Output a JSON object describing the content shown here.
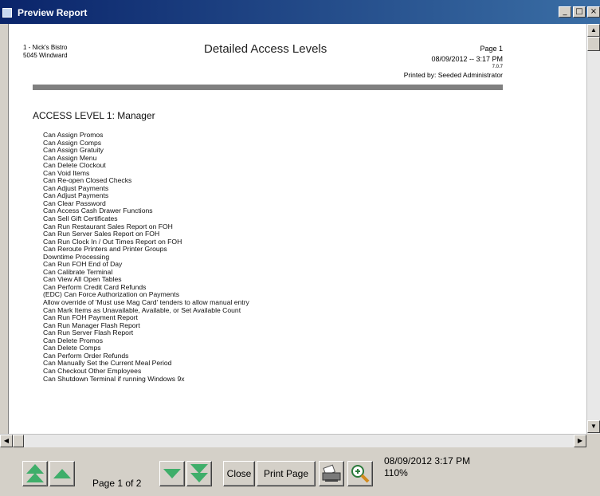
{
  "window": {
    "title": "Preview Report",
    "minimize_glyph": "_",
    "maximize_glyph": "□",
    "close_glyph": "×"
  },
  "report": {
    "restaurant_line1": "1 - Nick's Bistro",
    "restaurant_line2": "5045 Windward",
    "title": "Detailed Access Levels",
    "page": "Page 1",
    "datetime": "08/09/2012 --  3:17 PM",
    "version": "7.0.7",
    "printed_by": "Printed by: Seeded Administrator",
    "level_title": "ACCESS LEVEL 1: Manager",
    "permissions": [
      "Can Assign Promos",
      "Can Assign Comps",
      "Can Assign Gratuity",
      "Can Assign Menu",
      "Can Delete Clockout",
      "Can Void Items",
      "Can Re-open Closed Checks",
      "Can Adjust Payments",
      "Can Adjust Payments",
      "Can Clear Password",
      "Can Access Cash Drawer Functions",
      "Can Sell Gift Certificates",
      "Can Run Restaurant Sales Report on FOH",
      "Can Run Server Sales Report on FOH",
      "Can Run Clock In / Out Times Report on FOH",
      "Can Reroute Printers and Printer Groups",
      "Downtime Processing",
      "Can Run FOH End of Day",
      "Can Calibrate Terminal",
      "Can View All Open Tables",
      "Can Perform Credit Card Refunds",
      "(EDC) Can Force Authorization on Payments",
      "Allow override of 'Must use Mag Card' tenders to allow manual entry",
      "Can Mark Items as Unavailable, Available, or Set Available Count",
      "Can Run FOH Payment Report",
      "Can Run Manager Flash Report",
      "Can Run Server Flash Report",
      "Can Delete Promos",
      "Can Delete Comps",
      "Can Perform Order Refunds",
      "Can Manually Set the Current Meal Period",
      "Can Checkout Other Employees",
      "Can Shutdown Terminal if running Windows 9x"
    ]
  },
  "toolbar": {
    "first_page_icon": "double-up-arrow-icon",
    "prev_page_icon": "up-arrow-icon",
    "page_label": "Page 1 of 2",
    "next_page_icon": "down-arrow-icon",
    "last_page_icon": "double-down-arrow-icon",
    "close_label": "Close",
    "print_page_label": "Print Page",
    "printer_icon": "printer-icon",
    "zoom_icon": "zoom-in-icon",
    "status_datetime": "08/09/2012  3:17 PM",
    "zoom_level": "110%"
  },
  "colors": {
    "title_bar": "#0a246a",
    "nav_arrow": "#3fae6a",
    "chrome": "#d4d0c8"
  }
}
